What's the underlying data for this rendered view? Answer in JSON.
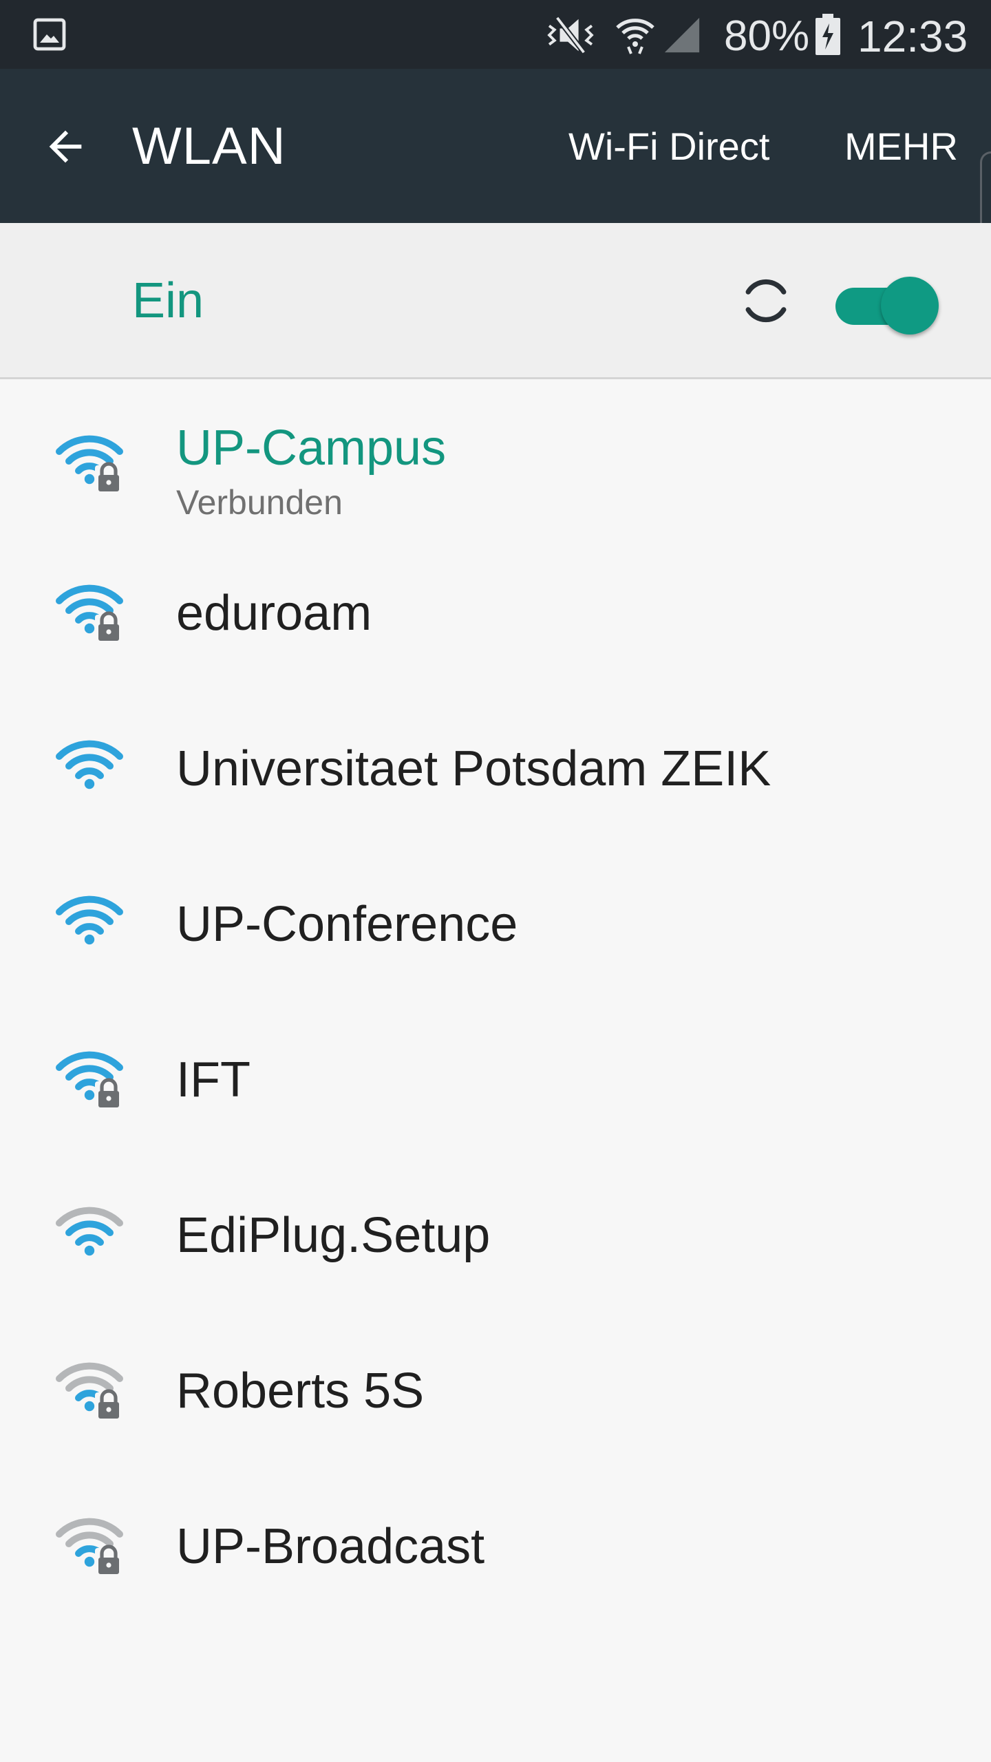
{
  "status_bar": {
    "battery_percent": "80%",
    "time": "12:33",
    "icons": [
      "gallery-icon",
      "mute-icon",
      "wifi-icon",
      "signal-icon",
      "battery-charging-icon"
    ]
  },
  "app_bar": {
    "title": "WLAN",
    "wifi_direct_label": "Wi-Fi Direct",
    "more_label": "MEHR"
  },
  "toggle": {
    "label": "Ein",
    "state": "on",
    "accent_color": "#13967f"
  },
  "networks": [
    {
      "name": "UP-Campus",
      "status": "Verbunden",
      "secured": true,
      "signal_level": 4,
      "connected": true
    },
    {
      "name": "eduroam",
      "secured": true,
      "signal_level": 4
    },
    {
      "name": "Universitaet Potsdam ZEIK",
      "secured": false,
      "signal_level": 4
    },
    {
      "name": "UP-Conference",
      "secured": false,
      "signal_level": 4
    },
    {
      "name": "IFT",
      "secured": true,
      "signal_level": 4
    },
    {
      "name": "EdiPlug.Setup",
      "secured": false,
      "signal_level": 3
    },
    {
      "name": "Roberts 5S",
      "secured": true,
      "signal_level": 2
    },
    {
      "name": "UP-Broadcast",
      "secured": true,
      "signal_level": 2
    }
  ]
}
